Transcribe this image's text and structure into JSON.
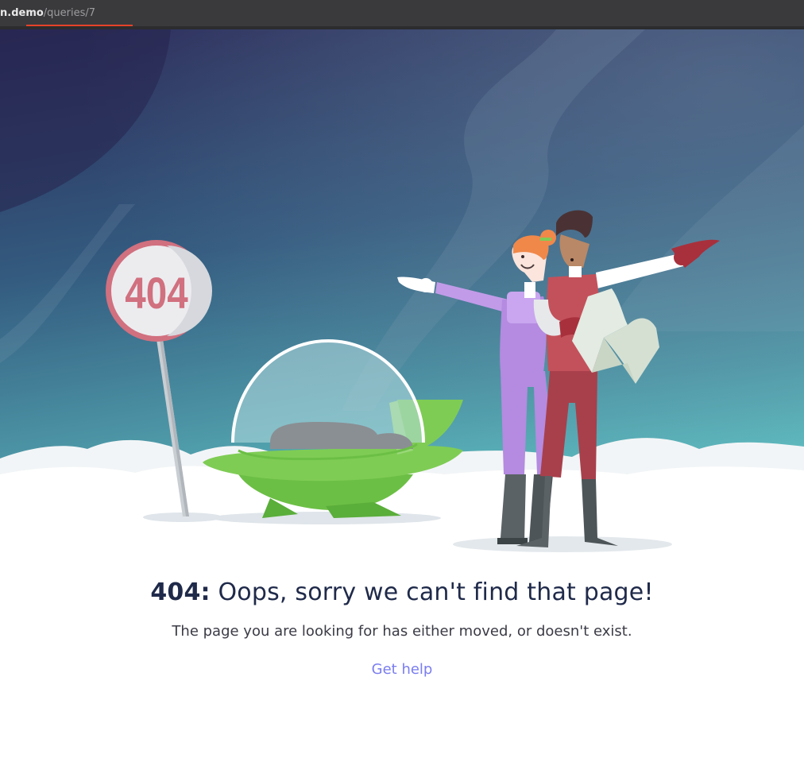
{
  "browser": {
    "url_host": "n.demo",
    "url_path": "/queries/7"
  },
  "sign": {
    "text": "404"
  },
  "error": {
    "code": "404:",
    "message": "Oops, sorry we can't find that page!",
    "description": "The page you are looking for has either moved, or doesn't exist.",
    "help_link": "Get help"
  },
  "colors": {
    "sky_top": "#2b2a58",
    "sky_bottom": "#5bbcc0",
    "link": "#7a7df0",
    "title": "#1f2a4a",
    "sign_red": "#d1707f"
  }
}
